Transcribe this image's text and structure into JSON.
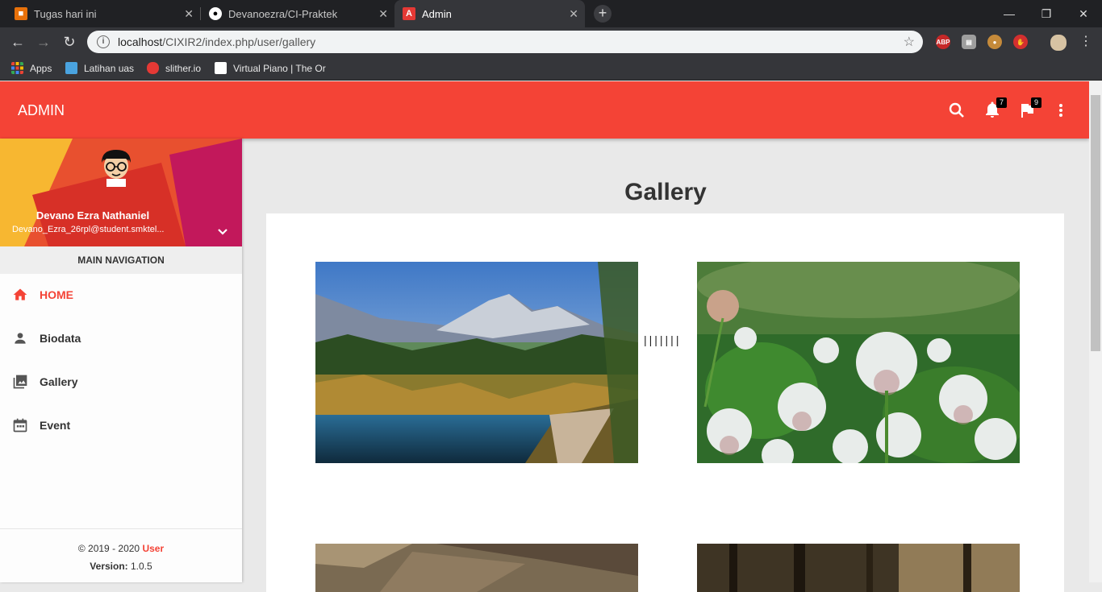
{
  "browser": {
    "tabs": [
      {
        "title": "Tugas hari ini"
      },
      {
        "title": "Devanoezra/CI-Praktek"
      },
      {
        "title": "Admin"
      }
    ],
    "url_host": "localhost",
    "url_path": "/CIXIR2/index.php/user/gallery",
    "bookmarks": [
      {
        "label": "Apps"
      },
      {
        "label": "Latihan uas"
      },
      {
        "label": "slither.io"
      },
      {
        "label": "Virtual Piano | The Or"
      }
    ],
    "extensions": {
      "abp_label": "ABP"
    }
  },
  "topbar": {
    "brand": "ADMIN",
    "notifications_count": "7",
    "flags_count": "9"
  },
  "sidebar": {
    "user_name": "Devano Ezra Nathaniel",
    "user_email": "Devano_Ezra_26rpl@student.smktel...",
    "nav_header": "MAIN NAVIGATION",
    "items": [
      {
        "label": "HOME",
        "icon": "home-icon",
        "active": true
      },
      {
        "label": "Biodata",
        "icon": "person-icon",
        "active": false
      },
      {
        "label": "Gallery",
        "icon": "photo-library-icon",
        "active": false
      },
      {
        "label": "Event",
        "icon": "calendar-icon",
        "active": false
      }
    ],
    "footer_copyright": "© 2019 - 2020 ",
    "footer_user": "User",
    "footer_version_label": "Version:",
    "footer_version": " 1.0.5"
  },
  "main": {
    "title": "Gallery",
    "separator": "|||||||"
  },
  "colors": {
    "accent": "#f44336",
    "browser_dark": "#202124",
    "toolbar": "#35363a"
  }
}
